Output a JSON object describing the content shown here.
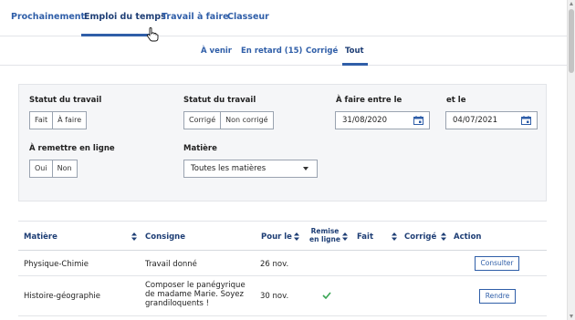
{
  "top_tabs": [
    "Prochainement",
    "Emploi du temps",
    "Travail à faire",
    "Classeur"
  ],
  "sub_tabs": [
    "À venir",
    "En retard (15)",
    "Corrigé",
    "Tout"
  ],
  "filters": {
    "status1": {
      "label": "Statut du travail",
      "options": [
        "Fait",
        "À faire"
      ]
    },
    "status2": {
      "label": "Statut du travail",
      "options": [
        "Corrigé",
        "Non corrigé"
      ]
    },
    "date_from": {
      "label": "À faire entre le",
      "value": "31/08/2020"
    },
    "date_to": {
      "label": "et le",
      "value": "04/07/2021"
    },
    "online": {
      "label": "À remettre en ligne",
      "options": [
        "Oui",
        "Non"
      ]
    },
    "subject": {
      "label": "Matière",
      "value": "Toutes les matières"
    }
  },
  "table": {
    "headers": [
      "Matière",
      "Consigne",
      "Pour le",
      "Remise en ligne",
      "Fait",
      "Corrigé",
      "Action"
    ],
    "rows": [
      {
        "subject": "Physique-Chimie",
        "instruction": "Travail donné",
        "due": "26 nov.",
        "online": false,
        "action": "Consulter"
      },
      {
        "subject": "Histoire-géographie",
        "instruction": "Composer le panégyrique de madame Marie. Soyez grandiloquents !",
        "due": "30 nov.",
        "online": true,
        "action": "Rendre"
      }
    ]
  },
  "colors": {
    "accent": "#2f5ea8",
    "accent_dark": "#1e3e75",
    "check": "#3aa655",
    "panel": "#f5f6f8"
  }
}
